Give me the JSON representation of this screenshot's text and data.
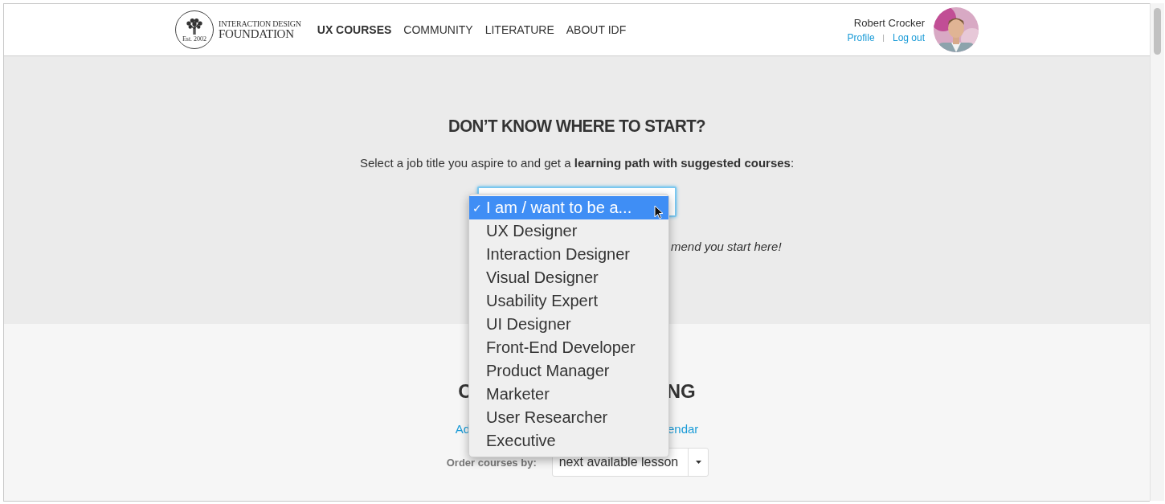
{
  "header": {
    "logo": {
      "line_1": "INTERACTION DESIGN",
      "line_2": "FOUNDATION",
      "year": "Est. 2002"
    },
    "nav": [
      {
        "label": "UX COURSES",
        "selected": true
      },
      {
        "label": "COMMUNITY",
        "selected": false
      },
      {
        "label": "LITERATURE",
        "selected": false
      },
      {
        "label": "ABOUT IDF",
        "selected": false
      }
    ],
    "user": {
      "name": "Robert Crocker",
      "links": [
        "Profile",
        "Log out"
      ],
      "separator": "|"
    }
  },
  "hero": {
    "title": "DON’T KNOW WHERE TO START?",
    "intro": "Select a job title you aspire to and get a **learning path with suggested courses**:",
    "job_select": {
      "focused": true,
      "options": [
        {
          "label": "I am / want to be a...",
          "selected": true
        },
        {
          "label": "UX Designer",
          "selected": false
        },
        {
          "label": "Interaction Designer",
          "selected": false
        },
        {
          "label": "Visual Designer",
          "selected": false
        },
        {
          "label": "Usability Expert",
          "selected": false
        },
        {
          "label": "UI Designer",
          "selected": false
        },
        {
          "label": "Front-End Developer",
          "selected": false
        },
        {
          "label": "Product Manager",
          "selected": false
        },
        {
          "label": "Marketer",
          "selected": false
        },
        {
          "label": "User Researcher",
          "selected": false
        },
        {
          "label": "Executive",
          "selected": false
        }
      ],
      "check_mark": "✓"
    },
    "hint": "mend you start here!"
  },
  "courses": {
    "heading_parts": [
      "C",
      "NG"
    ],
    "link_parts": [
      "Ad",
      "endar"
    ],
    "order": {
      "label": "Order courses by:",
      "value": "next available lesson"
    }
  }
}
